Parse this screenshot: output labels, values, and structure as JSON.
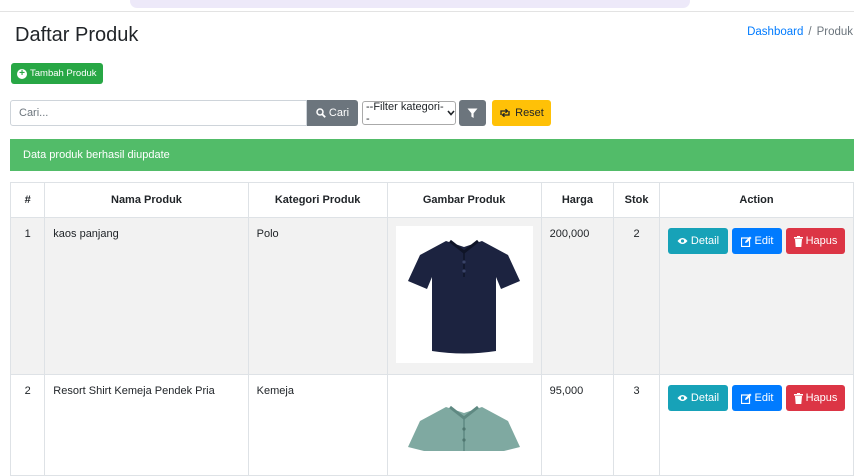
{
  "header": {
    "title": "Daftar Produk",
    "breadcrumb": {
      "home": "Dashboard",
      "separator": "/",
      "current": "Produk"
    }
  },
  "toolbar": {
    "add_label": "Tambah Produk",
    "search_placeholder": "Cari...",
    "search_button": "Cari",
    "category_selected": "--Filter kategori--",
    "reset_label": "Reset"
  },
  "alert": {
    "message": "Data produk berhasil diupdate"
  },
  "table": {
    "columns": [
      "#",
      "Nama Produk",
      "Kategori Produk",
      "Gambar Produk",
      "Harga",
      "Stok",
      "Action"
    ],
    "rows": [
      {
        "num": "1",
        "name": "kaos panjang",
        "category": "Polo",
        "image": "navy-polo-shirt",
        "price": "200,000",
        "stock": "2"
      },
      {
        "num": "2",
        "name": "Resort Shirt Kemeja Pendek Pria",
        "category": "Kemeja",
        "image": "sage-polo-shirt",
        "price": "95,000",
        "stock": "3"
      }
    ],
    "actions": {
      "detail": "Detail",
      "edit": "Edit",
      "hapus": "Hapus"
    }
  },
  "colors": {
    "add_button": "#28a745",
    "search_button": "#6c757d",
    "reset_button": "#ffc107",
    "alert": "#52bc69",
    "detail_button": "#17a2b8",
    "edit_button": "#007bff",
    "hapus_button": "#dc3545",
    "shirt_navy": "#1c2340",
    "shirt_sage": "#7fa9a1"
  }
}
